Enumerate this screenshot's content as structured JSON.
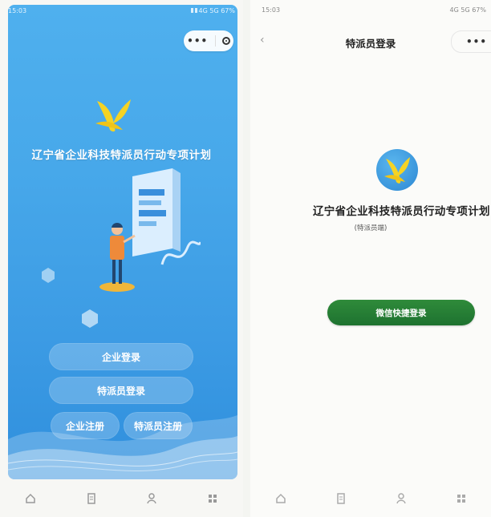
{
  "left": {
    "status": {
      "time": "15:03",
      "right": "4G 5G 67%"
    },
    "title": "辽宁省企业科技特派员行动专项计划",
    "buttons": {
      "enterprise_login": "企业登录",
      "specialist_login": "特派员登录",
      "enterprise_register": "企业注册",
      "specialist_register": "特派员注册"
    },
    "tabbar": [
      "home-icon",
      "document-icon",
      "user-icon",
      "grid-icon"
    ]
  },
  "right": {
    "status": {
      "time": "15:03",
      "right": "4G 5G 67%"
    },
    "nav": {
      "back": "‹",
      "title": "特派员登录"
    },
    "title": "辽宁省企业科技特派员行动专项计划",
    "subtitle": "(特派员端)",
    "wechat_login": "微信快捷登录",
    "tabbar": [
      "home-icon",
      "document-icon",
      "user-icon",
      "grid-icon"
    ]
  },
  "colors": {
    "brand_blue": "#47a8ea",
    "brand_yellow": "#f5d324",
    "wechat_green": "#2a8236"
  }
}
